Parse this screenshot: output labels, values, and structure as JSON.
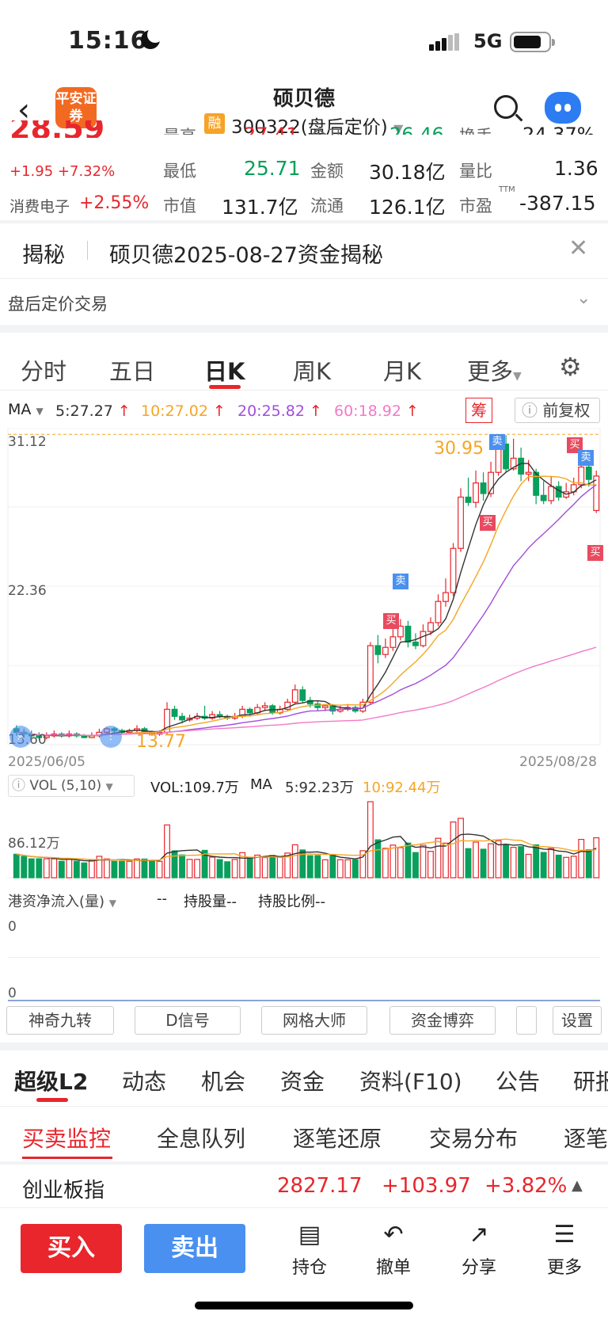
{
  "status": {
    "time": "15:16",
    "network": "5G"
  },
  "header": {
    "logo_text": "平安证券",
    "title": "硕贝德",
    "margin_badge": "融",
    "code": "300322(盘后定价)"
  },
  "quote": {
    "price": "28.59",
    "change": "+1.95",
    "change_pct": "+7.32%",
    "sector_name": "消费电子",
    "sector_pct": "+2.55%",
    "row_top": {
      "label1": "最高",
      "val1": "27.41",
      "label2": "今开",
      "val2": "26.46",
      "label3": "换手",
      "val3": "24.37%"
    },
    "row1": {
      "label1": "最低",
      "val1": "25.71",
      "label2": "金额",
      "val2": "30.18亿",
      "label3": "量比",
      "val3": "1.36"
    },
    "row2": {
      "label1": "市值",
      "val1": "131.7亿",
      "label2": "流通",
      "val2": "126.1亿",
      "label3": "市盈",
      "val3": "-387.15",
      "sup": "TTM"
    }
  },
  "reveal": {
    "label": "揭秘",
    "text": "硕贝德2025-08-27资金揭秘"
  },
  "after_hours": "盘后定价交易",
  "period_tabs": [
    "分时",
    "五日",
    "日K",
    "周K",
    "月K",
    "更多"
  ],
  "chart_header": {
    "ma_label": "MA",
    "ma5": "5:27.27",
    "ma10": "10:27.02",
    "ma20": "20:25.82",
    "ma60": "60:18.92",
    "chou": "筹",
    "fq": "前复权"
  },
  "chart_labels": {
    "max_price": "31.12",
    "mid_price": "22.36",
    "min_price": "13.60",
    "peak": "30.95",
    "low": "13.77",
    "date_start": "2025/06/05",
    "date_end": "2025/08/28"
  },
  "signals": {
    "sell": "卖",
    "buy": "买"
  },
  "vol_header": {
    "label": "VOL (5,10)",
    "vol": "VOL:109.7万",
    "ma": "MA",
    "ma5": "5:92.23万",
    "ma10": "10:92.44万",
    "axis": "86.12万"
  },
  "hk_header": {
    "label": "港资净流入(量)",
    "v1": "--",
    "hold": "持股量--",
    "ratio": "持股比例--",
    "axis_top": "0",
    "axis_bottom": "0"
  },
  "func_buttons": [
    "神奇九转",
    "D信号",
    "网格大师",
    "资金博弈",
    "",
    "设置"
  ],
  "main_tabs": [
    "超级L2",
    "动态",
    "机会",
    "资金",
    "资料(F10)",
    "公告",
    "研报"
  ],
  "sub_tabs": [
    "买卖监控",
    "全息队列",
    "逐笔还原",
    "交易分布",
    "逐笔"
  ],
  "index_bar": {
    "name": "创业板指",
    "value": "2827.17",
    "change": "+103.97",
    "pct": "+3.82%"
  },
  "bottom": {
    "buy": "买入",
    "sell": "卖出",
    "items": [
      "持仓",
      "撤单",
      "分享",
      "更多"
    ]
  },
  "colors": {
    "up": "#e8262c",
    "down": "#08a05c",
    "ma5": "#333",
    "ma10": "#f5a623",
    "ma20": "#a24ddb",
    "ma60": "#f27ac8",
    "accent": "#4a90f0"
  },
  "chart_data": {
    "type": "candlestick",
    "price_axis": {
      "max": 31.12,
      "mid": 22.36,
      "min": 13.6
    },
    "x_range": [
      "2025/06/05",
      "2025/08/28"
    ],
    "annotations": {
      "high": 30.95,
      "low": 13.77
    },
    "candles": [
      [
        14.3,
        14.1,
        14.5,
        13.9
      ],
      [
        14.1,
        14.0,
        14.3,
        13.8
      ],
      [
        14.0,
        13.9,
        14.2,
        13.8
      ],
      [
        13.9,
        13.8,
        14.1,
        13.7
      ],
      [
        13.8,
        13.9,
        14.1,
        13.7
      ],
      [
        13.9,
        14.0,
        14.2,
        13.8
      ],
      [
        14.0,
        13.9,
        14.1,
        13.8
      ],
      [
        13.9,
        14.0,
        14.2,
        13.8
      ],
      [
        14.0,
        13.9,
        14.1,
        13.8
      ],
      [
        13.9,
        13.8,
        14.0,
        13.77
      ],
      [
        13.8,
        13.9,
        14.1,
        13.77
      ],
      [
        13.9,
        14.1,
        14.3,
        13.8
      ],
      [
        14.1,
        14.3,
        14.4,
        14.0
      ],
      [
        14.3,
        14.2,
        14.4,
        14.1
      ],
      [
        14.2,
        14.1,
        14.3,
        14.0
      ],
      [
        14.1,
        14.2,
        14.3,
        14.0
      ],
      [
        14.2,
        14.3,
        14.5,
        14.1
      ],
      [
        14.3,
        14.1,
        14.4,
        14.0
      ],
      [
        14.1,
        14.0,
        14.2,
        13.9
      ],
      [
        14.0,
        14.1,
        14.2,
        13.9
      ],
      [
        14.1,
        15.4,
        15.8,
        14.0
      ],
      [
        15.4,
        15.0,
        15.6,
        14.8
      ],
      [
        15.0,
        14.8,
        15.2,
        14.6
      ],
      [
        14.8,
        14.9,
        15.1,
        14.7
      ],
      [
        14.9,
        15.0,
        15.2,
        14.8
      ],
      [
        15.0,
        14.9,
        15.6,
        14.8
      ],
      [
        14.9,
        15.1,
        15.3,
        14.8
      ],
      [
        15.1,
        15.0,
        15.3,
        14.9
      ],
      [
        15.0,
        14.9,
        15.1,
        14.8
      ],
      [
        14.9,
        15.0,
        15.2,
        14.8
      ],
      [
        15.0,
        15.4,
        15.6,
        14.9
      ],
      [
        15.4,
        15.2,
        15.5,
        15.0
      ],
      [
        15.2,
        15.5,
        15.7,
        15.1
      ],
      [
        15.5,
        15.6,
        15.8,
        15.3
      ],
      [
        15.6,
        15.2,
        15.7,
        15.1
      ],
      [
        15.2,
        15.4,
        15.6,
        15.1
      ],
      [
        15.4,
        15.8,
        16.0,
        15.3
      ],
      [
        15.8,
        16.5,
        16.8,
        15.7
      ],
      [
        16.5,
        15.9,
        16.7,
        15.8
      ],
      [
        15.9,
        15.7,
        16.1,
        15.5
      ],
      [
        15.7,
        15.5,
        15.9,
        15.3
      ],
      [
        15.5,
        15.6,
        15.7,
        15.3
      ],
      [
        15.6,
        15.3,
        15.7,
        15.1
      ],
      [
        15.3,
        15.4,
        15.6,
        15.2
      ],
      [
        15.4,
        15.5,
        15.7,
        15.3
      ],
      [
        15.5,
        15.3,
        15.6,
        15.2
      ],
      [
        15.3,
        15.8,
        16.0,
        15.2
      ],
      [
        15.8,
        19.0,
        19.2,
        15.7
      ],
      [
        19.0,
        18.5,
        19.6,
        18.0
      ],
      [
        18.5,
        18.9,
        19.4,
        18.3
      ],
      [
        18.9,
        19.5,
        20.0,
        18.7
      ],
      [
        19.5,
        20.1,
        20.5,
        19.3
      ],
      [
        20.1,
        19.2,
        20.4,
        18.9
      ],
      [
        19.2,
        19.0,
        19.7,
        18.8
      ],
      [
        19.0,
        19.8,
        20.2,
        18.9
      ],
      [
        19.8,
        20.3,
        20.6,
        19.6
      ],
      [
        20.3,
        21.5,
        21.9,
        20.1
      ],
      [
        21.5,
        22.0,
        22.8,
        21.2
      ],
      [
        22.0,
        24.5,
        24.8,
        21.8
      ],
      [
        24.5,
        27.4,
        27.9,
        24.3
      ],
      [
        27.4,
        27.1,
        28.5,
        26.9
      ],
      [
        27.1,
        28.2,
        28.9,
        26.8
      ],
      [
        28.2,
        27.6,
        28.8,
        27.2
      ],
      [
        27.6,
        28.8,
        29.4,
        27.4
      ],
      [
        28.8,
        30.4,
        30.95,
        28.6
      ],
      [
        30.4,
        29.0,
        30.9,
        28.8
      ],
      [
        29.0,
        29.6,
        30.7,
        28.9
      ],
      [
        29.6,
        28.7,
        30.2,
        28.3
      ],
      [
        28.7,
        28.8,
        29.5,
        28.3
      ],
      [
        28.8,
        27.5,
        29.0,
        27.0
      ],
      [
        27.5,
        27.2,
        28.3,
        27.0
      ],
      [
        27.2,
        28.0,
        28.6,
        27.0
      ],
      [
        28.0,
        27.4,
        28.3,
        27.2
      ],
      [
        27.4,
        27.7,
        28.2,
        27.3
      ],
      [
        27.7,
        28.1,
        28.5,
        27.5
      ],
      [
        28.1,
        29.1,
        30.3,
        27.9
      ],
      [
        29.1,
        28.4,
        29.6,
        28.0
      ],
      [
        26.64,
        28.59,
        28.9,
        26.5
      ]
    ],
    "volume_axis": "86.12万"
  }
}
